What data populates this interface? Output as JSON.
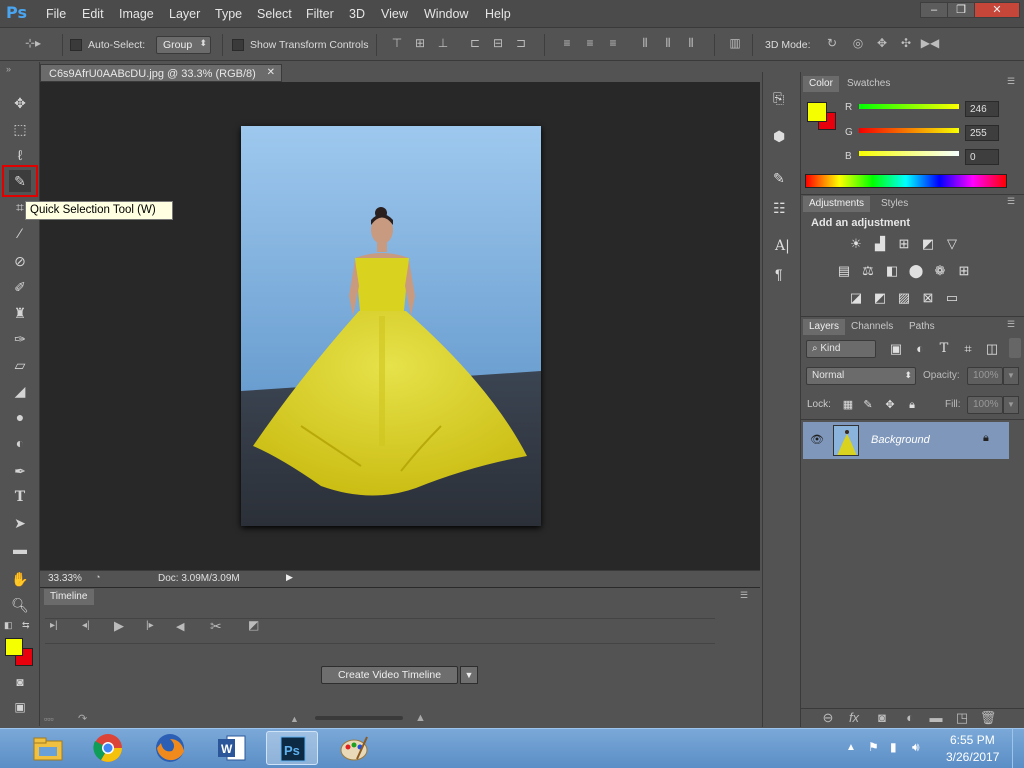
{
  "menubar": {
    "logo": "Ps",
    "items": [
      "File",
      "Edit",
      "Image",
      "Layer",
      "Type",
      "Select",
      "Filter",
      "3D",
      "View",
      "Window",
      "Help"
    ],
    "window_buttons": [
      "–",
      "❐",
      "✕"
    ]
  },
  "options": {
    "auto_select_label": "Auto-Select:",
    "group_value": "Group",
    "show_transform_label": "Show Transform Controls",
    "mode_3d_label": "3D Mode:"
  },
  "document": {
    "tab_title": "C6s9AfrU0AABcDU.jpg @ 33.3% (RGB/8)",
    "tab_close": "✕",
    "zoom": "33.33%",
    "doc_size": "Doc: 3.09M/3.09M"
  },
  "tooltip": {
    "text": "Quick Selection Tool (W)"
  },
  "timeline": {
    "tab_label": "Timeline",
    "create_button": "Create Video Timeline"
  },
  "color_panel": {
    "tabs": [
      "Color",
      "Swatches"
    ],
    "r_label": "R",
    "g_label": "G",
    "b_label": "B",
    "r_value": "246",
    "g_value": "255",
    "b_value": "0",
    "foreground": "#f6ff00",
    "background": "#e8000c"
  },
  "adjustments_panel": {
    "tabs": [
      "Adjustments",
      "Styles"
    ],
    "heading": "Add an adjustment"
  },
  "layers_panel": {
    "tabs": [
      "Layers",
      "Channels",
      "Paths"
    ],
    "kind_label": "Kind",
    "blend_mode": "Normal",
    "opacity_label": "Opacity:",
    "opacity_value": "100%",
    "lock_label": "Lock:",
    "fill_label": "Fill:",
    "fill_value": "100%",
    "layer_name": "Background"
  },
  "taskbar": {
    "time": "6:55 PM",
    "date": "3/26/2017"
  },
  "colors": {
    "accent_red": "#e00000",
    "layer_selected": "#7e97bb"
  }
}
